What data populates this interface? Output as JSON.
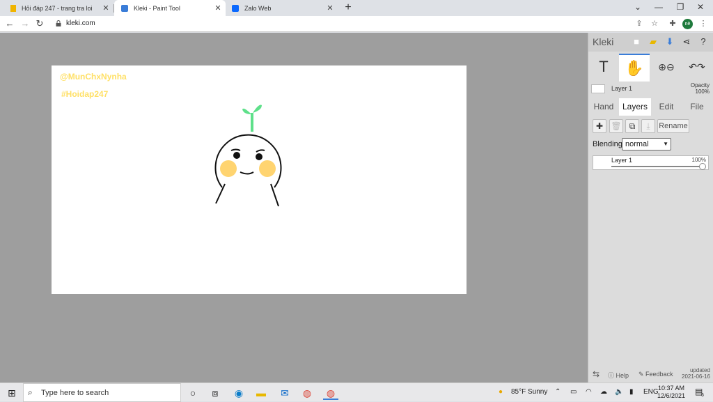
{
  "browser": {
    "tabs": [
      {
        "title": "Hỏi đáp 247 - trang tra loi",
        "favicon": "hoidap-favicon",
        "active": false
      },
      {
        "title": "Kleki - Paint Tool",
        "favicon": "kleki-favicon",
        "active": true
      },
      {
        "title": "Zalo Web",
        "favicon": "zalo-favicon",
        "active": false
      }
    ],
    "close_glyph": "✕",
    "new_tab_glyph": "+",
    "url": "kleki.com",
    "profile_initials": "nè"
  },
  "canvas": {
    "texts": [
      "@MunChxNynha",
      "#Hoidap247"
    ],
    "text_color": "#ffe066"
  },
  "kleki": {
    "logo": "Kleki",
    "layer_name": "Layer 1",
    "opacity_label": "Opacity",
    "opacity_value": "100%",
    "tabs": [
      "Hand",
      "Layers",
      "Edit",
      "File"
    ],
    "active_tab": "Layers",
    "rename_label": "Rename",
    "blending_label": "Blending",
    "blending_value": "normal",
    "layers": [
      {
        "name": "Layer 1",
        "opacity": "100%"
      }
    ],
    "help_label": "Help",
    "feedback_label": "Feedback",
    "updated_label": "updated",
    "updated_date": "2021-06-16",
    "accent": "#3a7dd8"
  },
  "taskbar": {
    "search_placeholder": "Type here to search",
    "weather": "85°F  Sunny",
    "language": "ENG",
    "time": "10:37 AM",
    "date": "12/6/2021",
    "notification_count": "6"
  }
}
